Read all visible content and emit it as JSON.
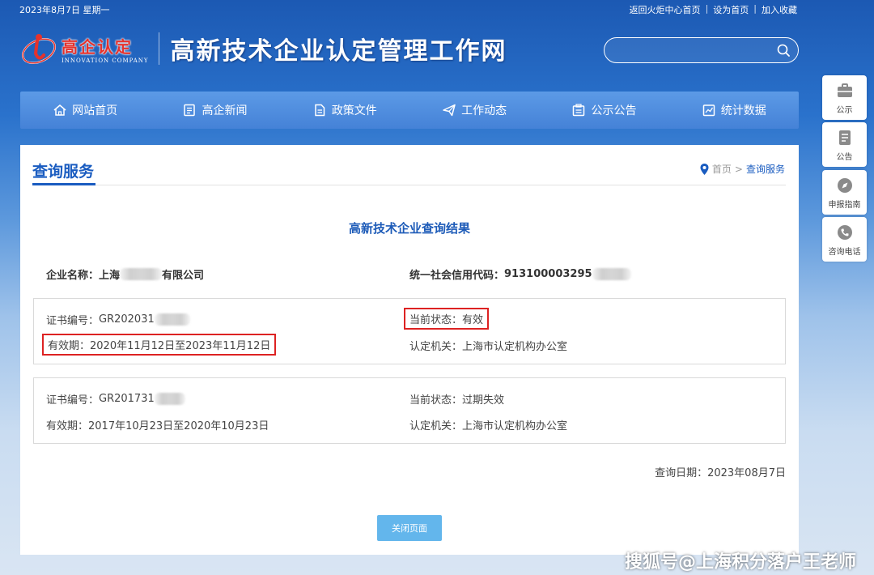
{
  "topbar": {
    "date": "2023年8月7日 星期一",
    "links": [
      "返回火炬中心首页",
      "设为首页",
      "加入收藏"
    ]
  },
  "header": {
    "logo_cn": "高企认定",
    "logo_en": "INNOVATION COMPANY",
    "site_title": "高新技术企业认定管理工作网",
    "search_placeholder": ""
  },
  "nav": {
    "items": [
      {
        "label": "网站首页",
        "icon": "home-icon"
      },
      {
        "label": "高企新闻",
        "icon": "news-icon"
      },
      {
        "label": "政策文件",
        "icon": "document-icon"
      },
      {
        "label": "工作动态",
        "icon": "paper-plane-icon"
      },
      {
        "label": "公示公告",
        "icon": "bulletin-icon"
      },
      {
        "label": "统计数据",
        "icon": "chart-icon"
      }
    ]
  },
  "sidebar": {
    "items": [
      {
        "label": "公示",
        "icon": "briefcase-icon"
      },
      {
        "label": "公告",
        "icon": "notice-icon"
      },
      {
        "label": "申报指南",
        "icon": "compass-icon"
      },
      {
        "label": "咨询电话",
        "icon": "phone-icon"
      }
    ]
  },
  "panel": {
    "title": "查询服务",
    "breadcrumb_home": "首页",
    "breadcrumb_sep": ">",
    "breadcrumb_current": "查询服务",
    "result_title": "高新技术企业查询结果",
    "company_name_label": "企业名称：",
    "company_name_prefix": "上海",
    "company_name_suffix": "有限公司",
    "credit_code_label": "统一社会信用代码：",
    "credit_code_visible": "913100003295",
    "certificates": [
      {
        "cert_no_label": "证书编号：",
        "cert_no": "GR202031",
        "status_label": "当前状态：",
        "status": "有效",
        "validity_label": "有效期：",
        "validity": "2020年11月12日至2023年11月12日",
        "authority_label": "认定机关：",
        "authority": "上海市认定机构办公室"
      },
      {
        "cert_no_label": "证书编号：",
        "cert_no": "GR201731",
        "status_label": "当前状态：",
        "status": "过期失效",
        "validity_label": "有效期：",
        "validity": "2017年10月23日至2020年10月23日",
        "authority_label": "认定机关：",
        "authority": "上海市认定机构办公室"
      }
    ],
    "query_date": "查询日期：2023年08月7日",
    "close_button": "关闭页面"
  },
  "watermark": "搜狐号@上海积分落户王老师",
  "colors": {
    "nav_blue": "#4b8ade",
    "title_blue": "#1a5cc0",
    "highlight_red": "#dd2222",
    "button_blue": "#63b6ec"
  }
}
